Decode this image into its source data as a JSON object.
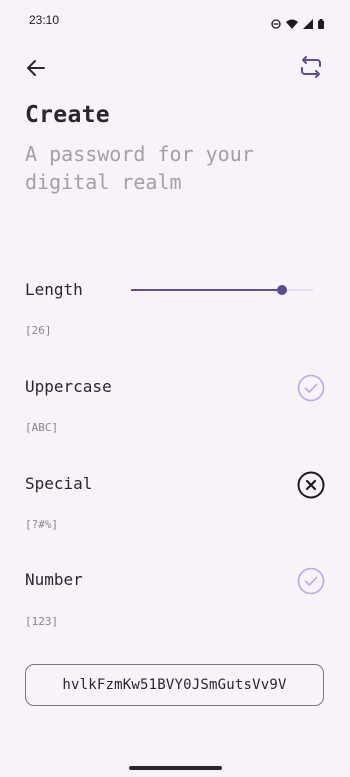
{
  "status_bar": {
    "time": "23:10",
    "icons": [
      "dnd-icon",
      "wifi-icon",
      "signal-icon",
      "battery-icon"
    ]
  },
  "header": {
    "back_icon": "arrow-left-icon",
    "regenerate_icon": "repeat-icon"
  },
  "title": "Create",
  "subtitle": "A password for your digital realm",
  "options": {
    "length": {
      "label": "Length",
      "hint": "[26]",
      "value": 26,
      "fraction": 0.83
    },
    "uppercase": {
      "label": "Uppercase",
      "hint": "[ABC]",
      "enabled": true
    },
    "special": {
      "label": "Special",
      "hint": "[?#%]",
      "enabled": false
    },
    "number": {
      "label": "Number",
      "hint": "[123]",
      "enabled": true
    }
  },
  "password": "hvlkFzmKw51BVY0JSmGutsVv9V",
  "colors": {
    "background": "#F8F2FA",
    "accent": "#5B4E8F",
    "check_enabled": "#B9A8E8",
    "check_disabled": "#1D1B20"
  }
}
